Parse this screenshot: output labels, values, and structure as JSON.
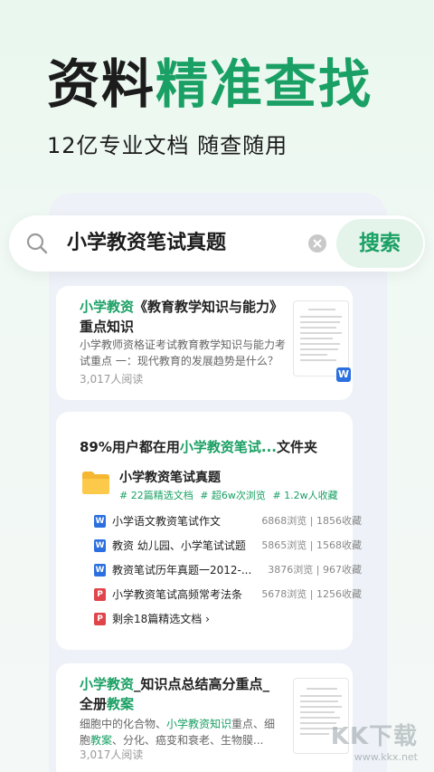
{
  "headline": {
    "part1": "资料",
    "part2": "精准查找"
  },
  "subheadline": "12亿专业文档  随查随用",
  "search": {
    "query": "小学教资笔试真题",
    "button_label": "搜索"
  },
  "result1": {
    "title_highlight": "小学教资",
    "title_rest": "《教育教学知识与能力》重点知识",
    "desc": "小学教师资格证考试教育教学知识与能力考试重点 一：现代教育的发展趋势是什么？答...",
    "reads": "3,017人阅读",
    "doc_badge": "W"
  },
  "folder_card": {
    "heading_prefix": "89%用户都在用",
    "heading_highlight": "小学教资笔试...",
    "heading_suffix": "文件夹",
    "folder_name": "小学教资笔试真题",
    "tags": [
      "# 22篇精选文档",
      "# 超6w次浏览",
      "# 1.2w人收藏"
    ],
    "files": [
      {
        "type": "W",
        "name": "小学语文教资笔试作文",
        "stats": "6868浏览 | 1856收藏",
        "color": "#2b6fe0"
      },
      {
        "type": "W",
        "name": "教资 幼儿园、小学笔试试题",
        "stats": "5865浏览 | 1568收藏",
        "color": "#2b6fe0"
      },
      {
        "type": "W",
        "name": "教资笔试历年真题一2012-...",
        "stats": "3876浏览 | 967收藏",
        "color": "#2b6fe0"
      },
      {
        "type": "P",
        "name": "小学教资笔试高频常考法条",
        "stats": "5678浏览 | 1256收藏",
        "color": "#e0454b"
      }
    ],
    "remaining": "剩余18篇精选文档 ›",
    "remaining_icon": "P"
  },
  "result2": {
    "title_highlight1": "小学教资",
    "title_mid": "_知识点总结高分重点_全册",
    "title_highlight2": "教案",
    "desc_a": "细胞中的化合物、",
    "desc_hl1": "小学教资知识",
    "desc_b": "重点、细胞",
    "desc_hl2": "教案",
    "desc_c": "、分化、癌变和衰老、生物膜...",
    "reads": "3,017人阅读"
  },
  "watermark": {
    "main": "KK下载",
    "sub": "www.kkx.net"
  }
}
